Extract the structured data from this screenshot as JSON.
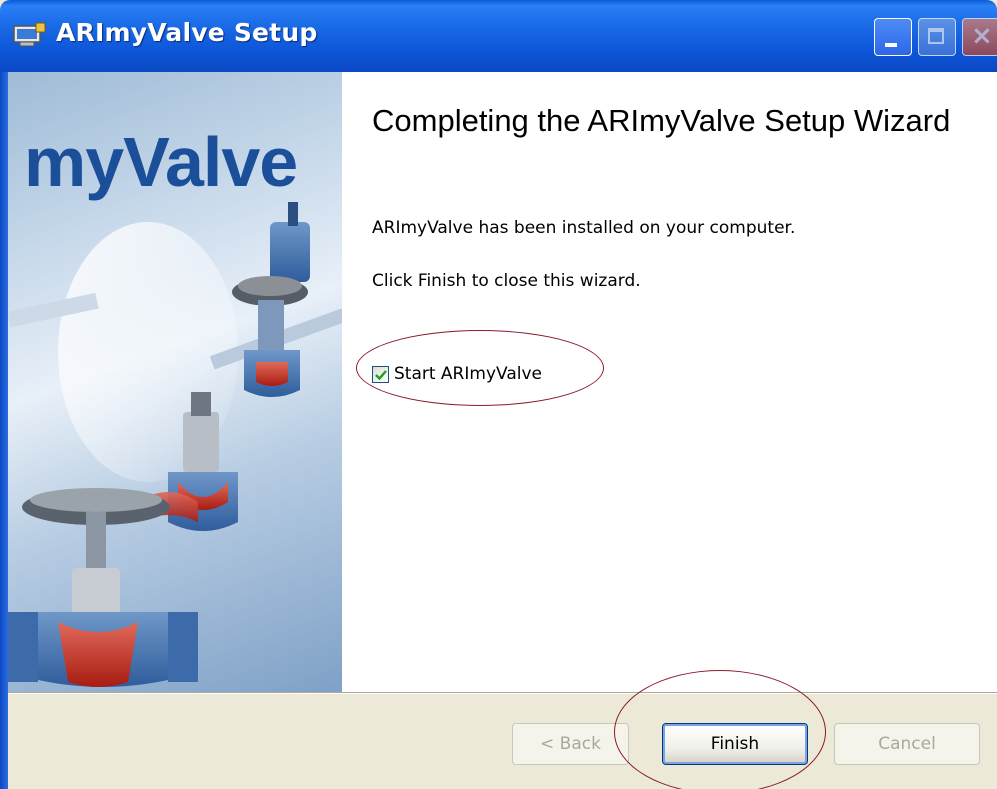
{
  "window": {
    "title": "ARImyValve Setup"
  },
  "banner": {
    "logo_text": "myValve"
  },
  "main": {
    "heading": "Completing the ARImyValve Setup Wizard",
    "installed_text": "ARImyValve has been installed on your computer.",
    "finish_hint": "Click Finish to close this wizard.",
    "start_checkbox": {
      "label": "Start ARImyValve",
      "checked": true
    }
  },
  "buttons": {
    "back_label": "< Back",
    "finish_label": "Finish",
    "cancel_label": "Cancel"
  },
  "colors": {
    "titlebar": "#0a5bd6",
    "checkmark": "#21a121",
    "annotation": "#8b1a2a"
  },
  "icons": {
    "app": "installer-icon",
    "minimize": "minimize-icon",
    "maximize": "maximize-icon",
    "close": "close-icon",
    "check": "checkmark-icon"
  }
}
